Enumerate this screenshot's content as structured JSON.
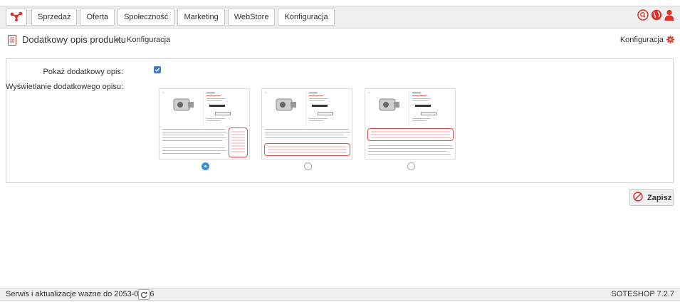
{
  "nav": {
    "items": [
      "Sprzedaż",
      "Oferta",
      "Społeczność",
      "Marketing",
      "WebStore",
      "Konfiguracja"
    ]
  },
  "header": {
    "title": "Dodatkowy opis produktu",
    "breadcrumb": "Konfiguracja",
    "config_link": "Konfiguracja"
  },
  "form": {
    "show_label": "Pokaż dodatkowy opis:",
    "show_checked": true,
    "display_label": "Wyświetlanie dodatkowego opisu:",
    "selected_option": 1
  },
  "save_label": "Zapisz",
  "footer": {
    "service_text": "Serwis i aktualizacje ważne do 2053-08-26",
    "version": "SOTESHOP 7.2.7"
  },
  "colors": {
    "accent": "#e23b3b",
    "checkbox": "#3a7ad7"
  }
}
